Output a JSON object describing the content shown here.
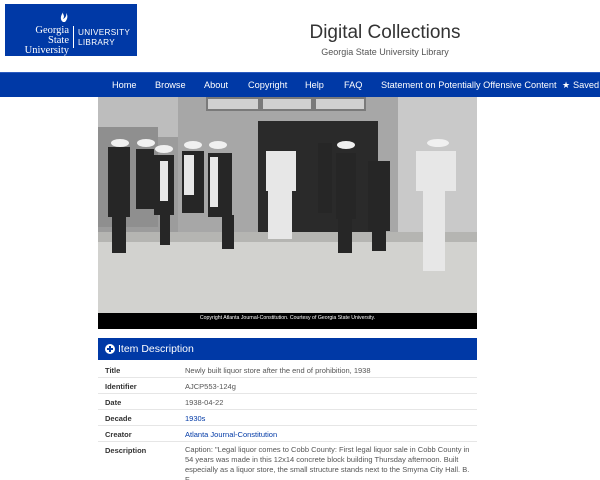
{
  "logo": {
    "line1": "Georgia State",
    "line2": "University",
    "right1": "UNIVERSITY",
    "right2": "LIBRARY"
  },
  "header": {
    "title": "Digital Collections",
    "subtitle": "Georgia State University Library"
  },
  "nav": {
    "home": "Home",
    "browse": "Browse",
    "about": "About",
    "copyright": "Copyright",
    "help": "Help",
    "faq": "FAQ",
    "statement": "Statement on Potentially Offensive Content",
    "saved": "Saved I"
  },
  "photo": {
    "caption": "Copyright Atlanta Journal-Constitution. Courtesy of Georgia State University."
  },
  "section": {
    "title": "Item Description"
  },
  "metadata": {
    "title_label": "Title",
    "title_value": "Newly built liquor store after the end of prohibition, 1938",
    "identifier_label": "Identifier",
    "identifier_value": "AJCP553-124g",
    "date_label": "Date",
    "date_value": "1938-04-22",
    "decade_label": "Decade",
    "decade_value": "1930s",
    "creator_label": "Creator",
    "creator_value": "Atlanta Journal-Constitution",
    "description_label": "Description",
    "description_value": "Caption: \"Legal liquor comes to Cobb County: First legal liquor sale in Cobb County in 54 years was made in this 12x14 concrete block building Thursday afternoon. Built especially as a liquor store, the small structure stands next to the Smyrna City Hall. B. F."
  },
  "colors": {
    "brand_blue": "#0039a6"
  }
}
